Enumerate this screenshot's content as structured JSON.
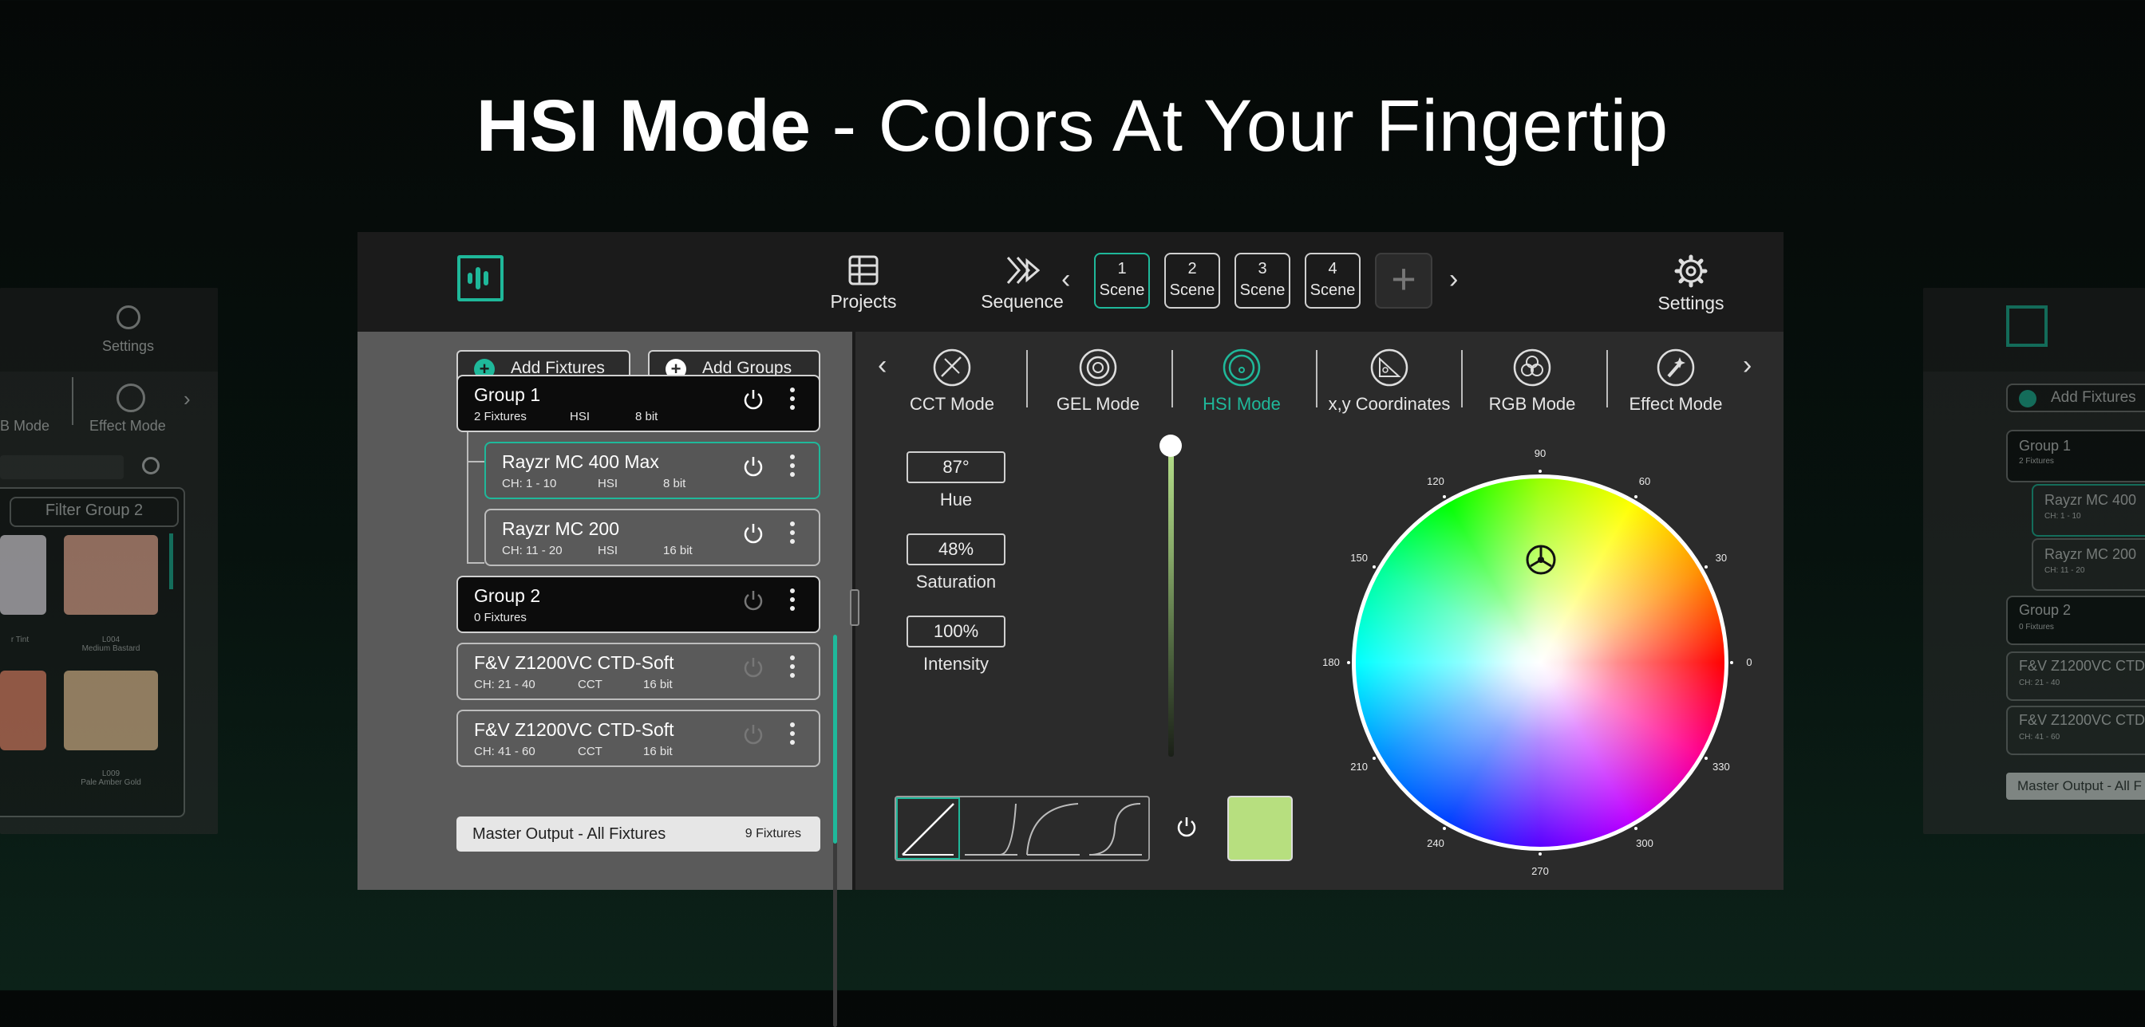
{
  "headline": {
    "bold": "HSI Mode",
    "rest": " - Colors At Your Fingertip"
  },
  "colors": {
    "accent": "#1fb89a",
    "selected_swatch": "#b7df7f"
  },
  "topbar": {
    "projects_label": "Projects",
    "sequence_label": "Sequence",
    "settings_label": "Settings",
    "scenes": [
      {
        "number": "1",
        "label": "Scene",
        "active": true
      },
      {
        "number": "2",
        "label": "Scene",
        "active": false
      },
      {
        "number": "3",
        "label": "Scene",
        "active": false
      },
      {
        "number": "4",
        "label": "Scene",
        "active": false
      }
    ],
    "add_scene_label": "+"
  },
  "left_panel": {
    "add_fixtures_label": "Add Fixtures",
    "add_groups_label": "Add Groups",
    "rows": [
      {
        "name": "Group 1",
        "ch": "2 Fixtures",
        "mode": "HSI",
        "bits": "8 bit",
        "type": "group",
        "power_on": true
      },
      {
        "name": "Rayzr MC 400 Max",
        "ch": "CH: 1 - 10",
        "mode": "HSI",
        "bits": "8 bit",
        "type": "fixture",
        "power_on": true
      },
      {
        "name": "Rayzr MC 200",
        "ch": "CH: 11 - 20",
        "mode": "HSI",
        "bits": "16 bit",
        "type": "fixture",
        "power_on": true
      },
      {
        "name": "Group 2",
        "ch": "0 Fixtures",
        "mode": "",
        "bits": "",
        "type": "group",
        "power_on": false
      },
      {
        "name": "F&V Z1200VC CTD-Soft",
        "ch": "CH: 21 - 40",
        "mode": "CCT",
        "bits": "16 bit",
        "type": "fixture",
        "power_on": false
      },
      {
        "name": "F&V Z1200VC CTD-Soft",
        "ch": "CH: 41 - 60",
        "mode": "CCT",
        "bits": "16 bit",
        "type": "fixture",
        "power_on": false
      }
    ],
    "master_label": "Master Output - All Fixtures",
    "master_count": "9 Fixtures"
  },
  "modes": [
    {
      "label": "CCT Mode",
      "icon": "cct-icon",
      "active": false
    },
    {
      "label": "GEL Mode",
      "icon": "gel-icon",
      "active": false
    },
    {
      "label": "HSI Mode",
      "icon": "hsi-icon",
      "active": true
    },
    {
      "label": "x,y Coordinates",
      "icon": "xy-icon",
      "active": false
    },
    {
      "label": "RGB Mode",
      "icon": "rgb-icon",
      "active": false
    },
    {
      "label": "Effect Mode",
      "icon": "effect-icon",
      "active": false
    }
  ],
  "hsi": {
    "hue_value": "87°",
    "hue_label": "Hue",
    "saturation_value": "48%",
    "saturation_label": "Saturation",
    "intensity_value": "100%",
    "intensity_label": "Intensity",
    "intensity_level": 1.0
  },
  "wheel_degrees": [
    "90",
    "60",
    "30",
    "0",
    "330",
    "300",
    "270",
    "240",
    "210",
    "180",
    "150",
    "120"
  ],
  "ghost_left": {
    "settings_label": "Settings",
    "mode1_label": "B Mode",
    "mode2_label": "Effect Mode",
    "filter_label": "Filter Group 2",
    "swatch_labels": [
      "r Tint",
      "L004\nMedium Bastard",
      "",
      "L009\nPale Amber Gold"
    ]
  },
  "ghost_right": {
    "add_label": "Add Fixtures",
    "rows": [
      "Group 1",
      "Rayzr MC 400",
      "Rayzr MC 200",
      "Group 2",
      "F&V Z1200VC CTD",
      "F&V Z1200VC CTD"
    ],
    "row_subs": [
      "2 Fixtures",
      "CH: 1 - 10",
      "CH: 11 - 20",
      "0 Fixtures",
      "CH: 21 - 40",
      "CH: 41 - 60"
    ],
    "master_label": "Master Output - All F"
  }
}
